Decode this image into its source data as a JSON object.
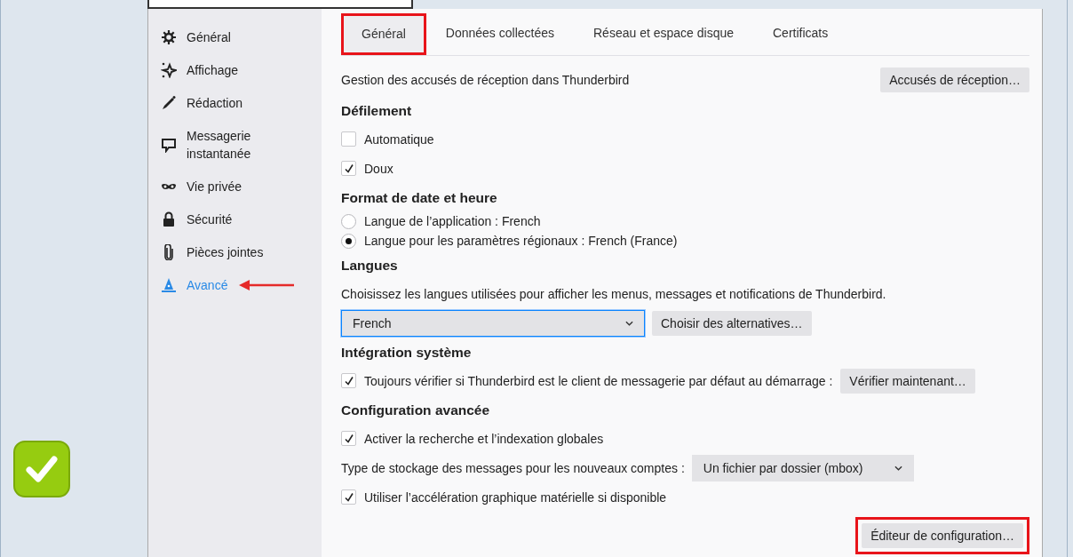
{
  "sidebar": {
    "items": [
      {
        "label": "Général",
        "selected": false,
        "pointed_by_arrow": false
      },
      {
        "label": "Affichage",
        "selected": false,
        "pointed_by_arrow": false
      },
      {
        "label": "Rédaction",
        "selected": false,
        "pointed_by_arrow": false
      },
      {
        "label": "Messagerie instantanée",
        "selected": false,
        "pointed_by_arrow": false
      },
      {
        "label": "Vie privée",
        "selected": false,
        "pointed_by_arrow": false
      },
      {
        "label": "Sécurité",
        "selected": false,
        "pointed_by_arrow": false
      },
      {
        "label": "Pièces jointes",
        "selected": false,
        "pointed_by_arrow": false
      },
      {
        "label": "Avancé",
        "selected": true,
        "pointed_by_arrow": true
      }
    ]
  },
  "tabs": [
    {
      "label": "Général",
      "selected": true,
      "highlighted": true
    },
    {
      "label": "Données collectées",
      "selected": false,
      "highlighted": false
    },
    {
      "label": "Réseau et espace disque",
      "selected": false,
      "highlighted": false
    },
    {
      "label": "Certificats",
      "selected": false,
      "highlighted": false
    }
  ],
  "rows": [
    {
      "kind": "text-button",
      "text": "Gestion des accusés de réception dans Thunderbird",
      "button": "Accusés de réception…"
    },
    {
      "kind": "heading",
      "text": "Défilement"
    },
    {
      "kind": "checkbox",
      "text": "Automatique",
      "checked": false
    },
    {
      "kind": "checkbox",
      "text": "Doux",
      "checked": true
    },
    {
      "kind": "heading",
      "text": "Format de date et heure"
    },
    {
      "kind": "radio",
      "text": "Langue de l’application : French",
      "selected": false
    },
    {
      "kind": "radio",
      "text": "Langue pour les paramètres régionaux : French (France)",
      "selected": true
    },
    {
      "kind": "heading",
      "text": "Langues"
    },
    {
      "kind": "text",
      "text": "Choisissez les langues utilisées pour afficher les menus, messages et notifications de Thunderbird."
    },
    {
      "kind": "select-button",
      "value": "French",
      "button": "Choisir des alternatives…",
      "focused": true
    },
    {
      "kind": "heading",
      "text": "Intégration système"
    },
    {
      "kind": "checkbox-button",
      "text": "Toujours vérifier si Thunderbird est le client de messagerie par défaut au démarrage :",
      "checked": true,
      "button": "Vérifier maintenant…"
    },
    {
      "kind": "heading",
      "text": "Configuration avancée"
    },
    {
      "kind": "checkbox",
      "text": "Activer la recherche et l’indexation globales",
      "checked": true
    },
    {
      "kind": "label-select",
      "text": "Type de stockage des messages pour les nouveaux comptes :",
      "value": "Un fichier par dossier (mbox)",
      "focused": false
    },
    {
      "kind": "checkbox",
      "text": "Utiliser l’accélération graphique matérielle si disponible",
      "checked": true
    },
    {
      "kind": "button-right",
      "button": "Éditeur de configuration…",
      "highlighted": true
    }
  ]
}
